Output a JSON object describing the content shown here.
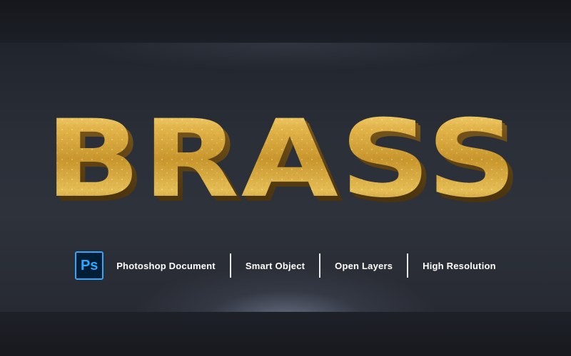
{
  "headline": {
    "text": "BRASS"
  },
  "badge": {
    "text": "Ps",
    "icon": "photoshop-icon",
    "colors": {
      "background": "#001e36",
      "accent": "#31a8ff"
    }
  },
  "features": [
    {
      "label": "Photoshop Document"
    },
    {
      "label": "Smart Object"
    },
    {
      "label": "Open Layers"
    },
    {
      "label": "High Resolution"
    }
  ],
  "colors": {
    "background": "#2b2f38",
    "gold_light": "#f6d46a",
    "gold_mid": "#d3a537",
    "gold_dark": "#7a5718",
    "text": "#ffffff"
  }
}
